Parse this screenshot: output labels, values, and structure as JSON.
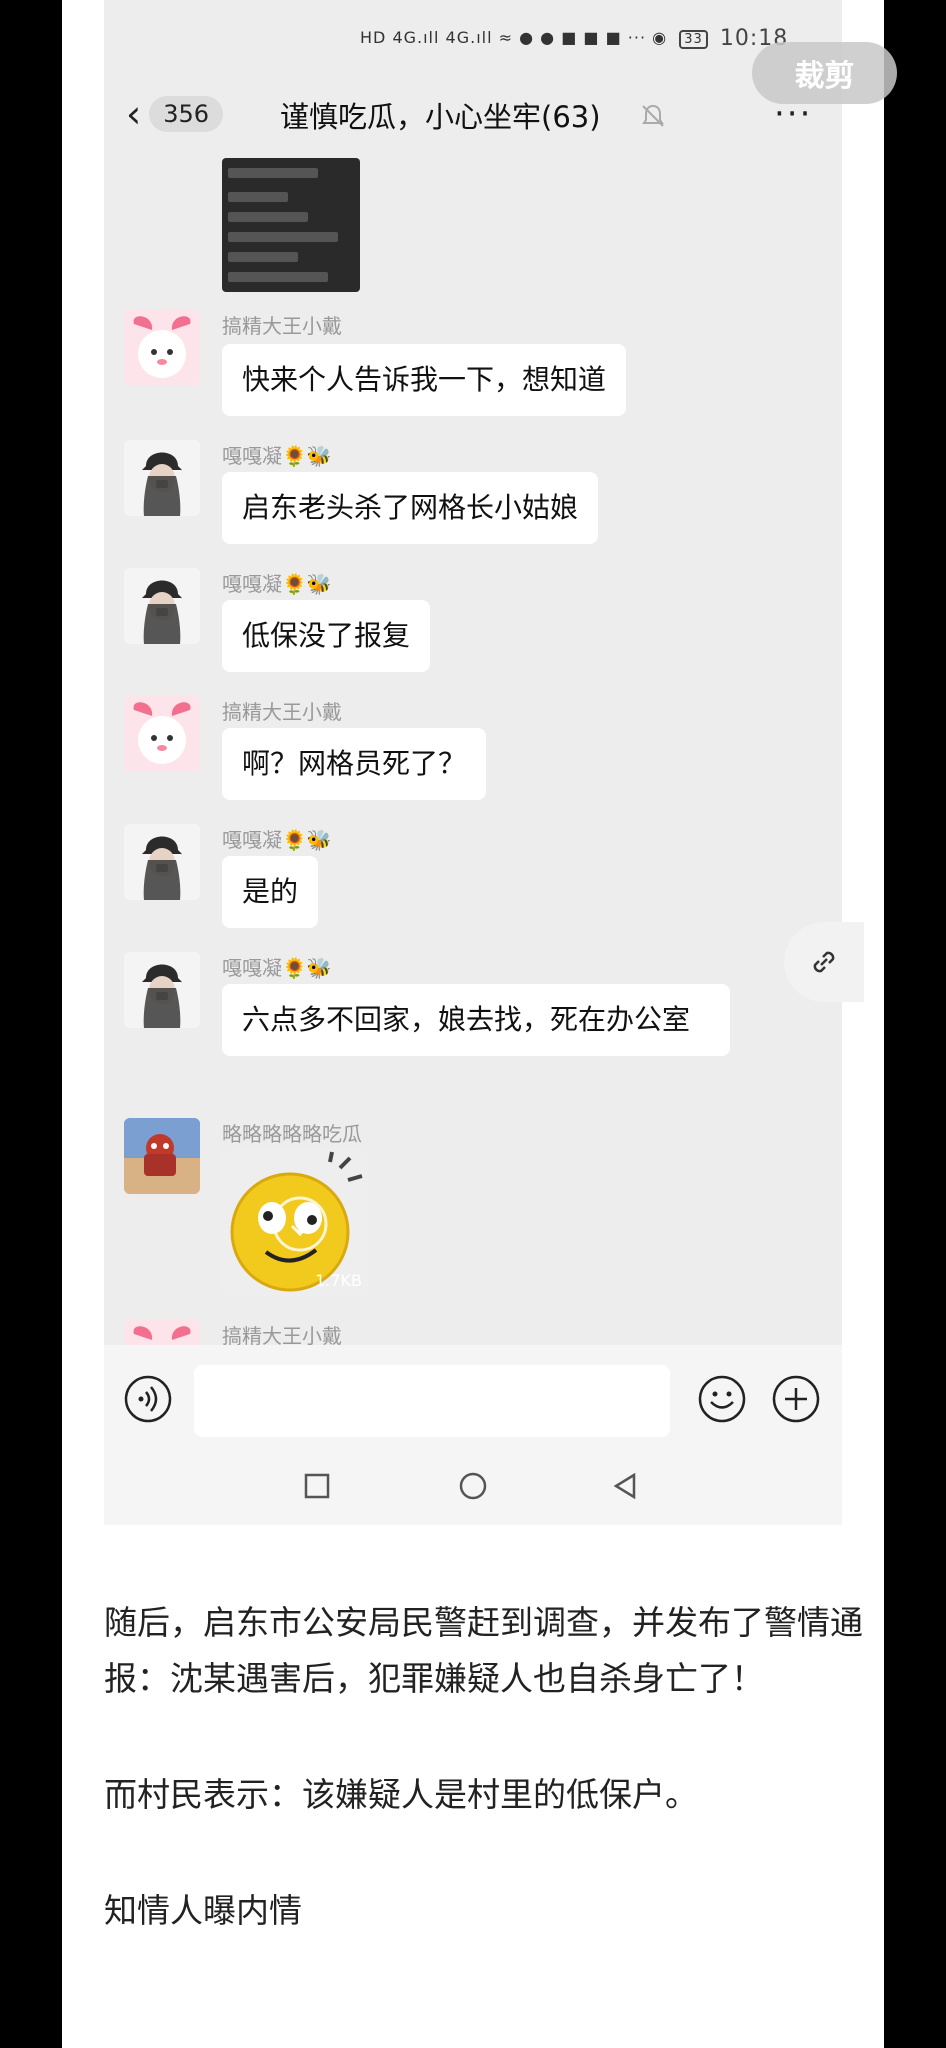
{
  "status_bar": {
    "icons_text": "HD 4G.ıll 4G.ıll ≈ ● ● ■ ■ ■ ··· ◉",
    "battery": "33",
    "time": "10:18"
  },
  "crop_overlay": {
    "label": "裁剪"
  },
  "header": {
    "unread_count": "356",
    "title": "谨慎吃瓜，小心坐牢(63)"
  },
  "messages": [
    {
      "sender": "搞精大王小戴",
      "text": "快来个人告诉我一下，想知道",
      "avatar": "pink-bunny"
    },
    {
      "sender": "嘎嘎凝🌻🐝",
      "text": "启东老头杀了网格长小姑娘",
      "avatar": "girl-cap"
    },
    {
      "sender": "嘎嘎凝🌻🐝",
      "text": "低保没了报复",
      "avatar": "girl-cap"
    },
    {
      "sender": "搞精大王小戴",
      "text": "啊？网格员死了？",
      "avatar": "pink-bunny"
    },
    {
      "sender": "嘎嘎凝🌻🐝",
      "text": "是的",
      "avatar": "girl-cap"
    },
    {
      "sender": "嘎嘎凝🌻🐝",
      "text": "六点多不回家，娘去找，死在办公室",
      "avatar": "girl-cap"
    },
    {
      "sender": "略略略略略吃瓜",
      "sticker_size": "1.7KB",
      "avatar": "cartoon"
    },
    {
      "sender": "搞精大王小戴",
      "avatar": "pink-bunny"
    }
  ],
  "article": {
    "paragraphs": [
      "随后，启东市公安局民警赶到调查，并发布了警情通报：沈某遇害后，犯罪嫌疑人也自杀身亡了！",
      "而村民表示：该嫌疑人是村里的低保户。",
      "知情人曝内情"
    ]
  }
}
